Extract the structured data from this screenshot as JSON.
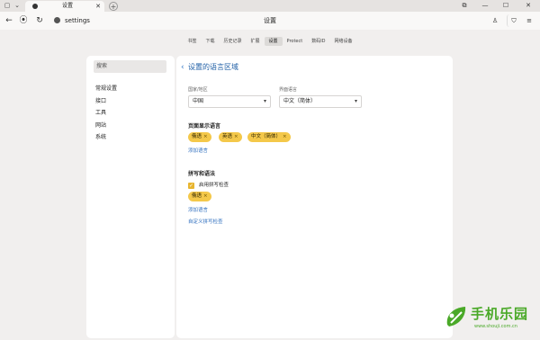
{
  "tabs": [
    {
      "title": "设置",
      "close": "✕"
    }
  ],
  "newtab_glyph": "+",
  "window_controls": [
    "⧉",
    "—",
    "☐",
    "✕"
  ],
  "address_bar": {
    "url": "settings",
    "page_title": "设置"
  },
  "toolbar_icons": [
    "user-icon",
    "shield-icon",
    "menu-icon"
  ],
  "top_nav": {
    "items": [
      "书签",
      "下载",
      "历史记录",
      "扩展",
      "设置",
      "Protect",
      "数码ID",
      "网络设备"
    ],
    "active_index": 4
  },
  "sidebar": {
    "search_placeholder": "搜索",
    "items": [
      "常规设置",
      "接口",
      "工具",
      "网站",
      "系统"
    ]
  },
  "main": {
    "back_glyph": "‹",
    "title": "设置的语言区域",
    "region": {
      "label": "国家/地区",
      "value": "中国"
    },
    "ui_language": {
      "label": "界面语言",
      "value": "中文（简体）"
    },
    "page_languages": {
      "heading": "页面显示语言",
      "chips": [
        "俄语",
        "英语",
        "中文（简体）"
      ],
      "add_link": "添加语言"
    },
    "spelling": {
      "heading": "拼写和语法",
      "checkbox_label": "启用拼写检查",
      "checked": true,
      "chips": [
        "俄语"
      ],
      "add_link": "添加语言",
      "custom_link": "自定义拼写检查"
    }
  },
  "watermark": {
    "text": "手机乐园",
    "url": "www.shouji.com.cn"
  },
  "colors": {
    "accent": "#2f6fbf",
    "chip": "#f4c84a",
    "checkbox": "#e8b52f",
    "watermark": "#4aa928"
  }
}
